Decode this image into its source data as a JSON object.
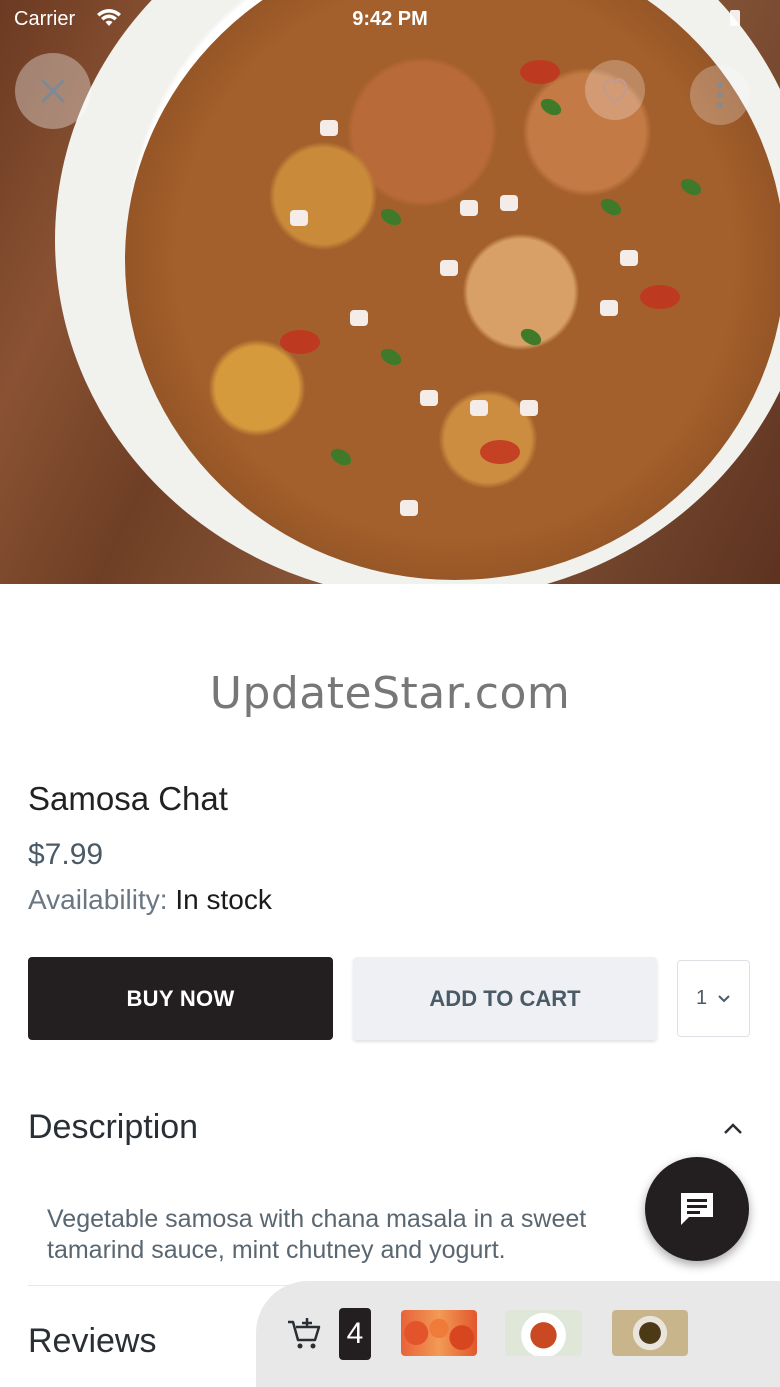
{
  "status_bar": {
    "carrier": "Carrier",
    "time": "9:42 PM"
  },
  "hero": {
    "image": "samosa-chat-photo",
    "actions": [
      "close-icon",
      "heart-icon",
      "more-vertical-icon"
    ]
  },
  "watermark": "UpdateStar.com",
  "product": {
    "title": "Samosa Chat",
    "price": "$7.99",
    "availability_label": "Availability:",
    "availability_value": "In stock"
  },
  "actions": {
    "buy_now": "BUY NOW",
    "add_to_cart": "ADD TO CART",
    "quantity": "1"
  },
  "description": {
    "heading": "Description",
    "text": "Vegetable samosa with chana masala in a sweet tamarind sauce, mint chutney and yogurt."
  },
  "reviews": {
    "heading": "Reviews"
  },
  "cart_bar": {
    "count": "4",
    "thumbnails": [
      "food-thumbnail-1",
      "food-thumbnail-2",
      "food-thumbnail-3"
    ]
  },
  "colors": {
    "primary_dark": "#231f20",
    "secondary_button": "#eef0f3",
    "price_text": "#4a5a66"
  }
}
